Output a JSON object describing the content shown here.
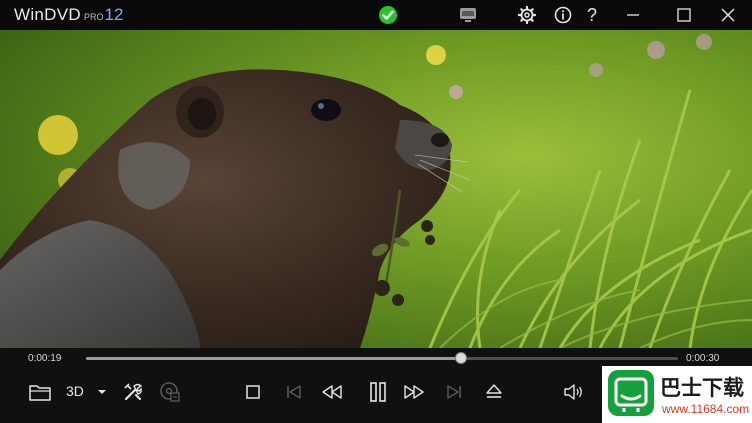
{
  "app": {
    "name": "WinDVD",
    "edition": "PRO",
    "version": "12"
  },
  "titlebar": {
    "status_icon": "check-circle-icon",
    "screen_icon": "display-icon",
    "settings_icon": "gear-icon",
    "info_icon": "info-icon",
    "help_label": "?",
    "minimize_icon": "minimize-icon",
    "maximize_icon": "maximize-icon",
    "close_icon": "close-icon"
  },
  "playback": {
    "current_time": "0:00:19",
    "total_time": "0:00:30",
    "progress_fraction": 0.633
  },
  "controls": {
    "label_3d": "3D",
    "icons": [
      "folder-icon",
      "chevron-down-icon",
      "tools-icon",
      "disc-icon",
      "stop-icon",
      "previous-chapter-icon",
      "rewind-icon",
      "pause-icon",
      "fast-forward-icon",
      "next-chapter-icon",
      "eject-icon",
      "volume-icon"
    ]
  },
  "watermark": {
    "text": "巴士下载",
    "url": "www.11684.com"
  },
  "colors": {
    "accent_check": "#2ec12e",
    "background": "#101010",
    "watermark_green": "#14a13b",
    "watermark_red": "#d7391e"
  }
}
